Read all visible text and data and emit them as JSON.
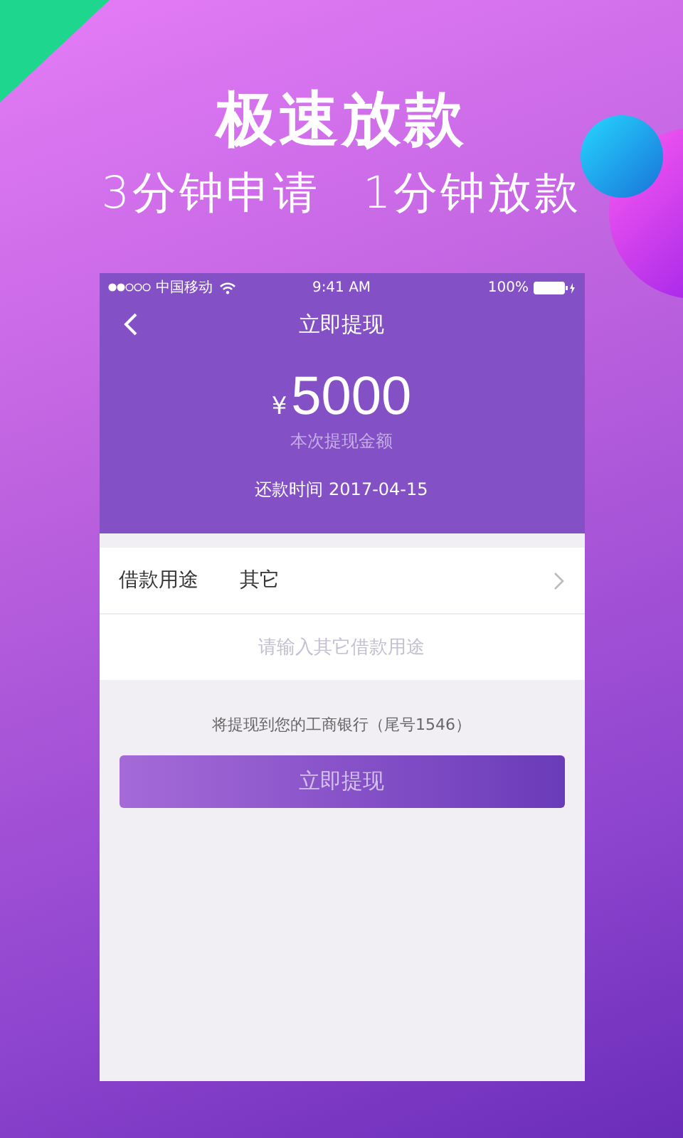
{
  "headline": "极速放款",
  "taglines": [
    "3分钟申请",
    "1分钟放款"
  ],
  "status_bar": {
    "carrier": "中国移动",
    "time": "9:41 AM",
    "battery": "100%"
  },
  "nav": {
    "title": "立即提现"
  },
  "summary": {
    "currency": "¥",
    "amount": "5000",
    "amount_label": "本次提现金额",
    "repay_date": "还款时间 2017-04-15"
  },
  "purpose": {
    "label": "借款用途",
    "value": "其它"
  },
  "other_purpose": {
    "placeholder": "请输入其它借款用途"
  },
  "note": "将提现到您的工商银行（尾号1546）",
  "submit": {
    "label": "立即提现",
    "disabled": true
  }
}
